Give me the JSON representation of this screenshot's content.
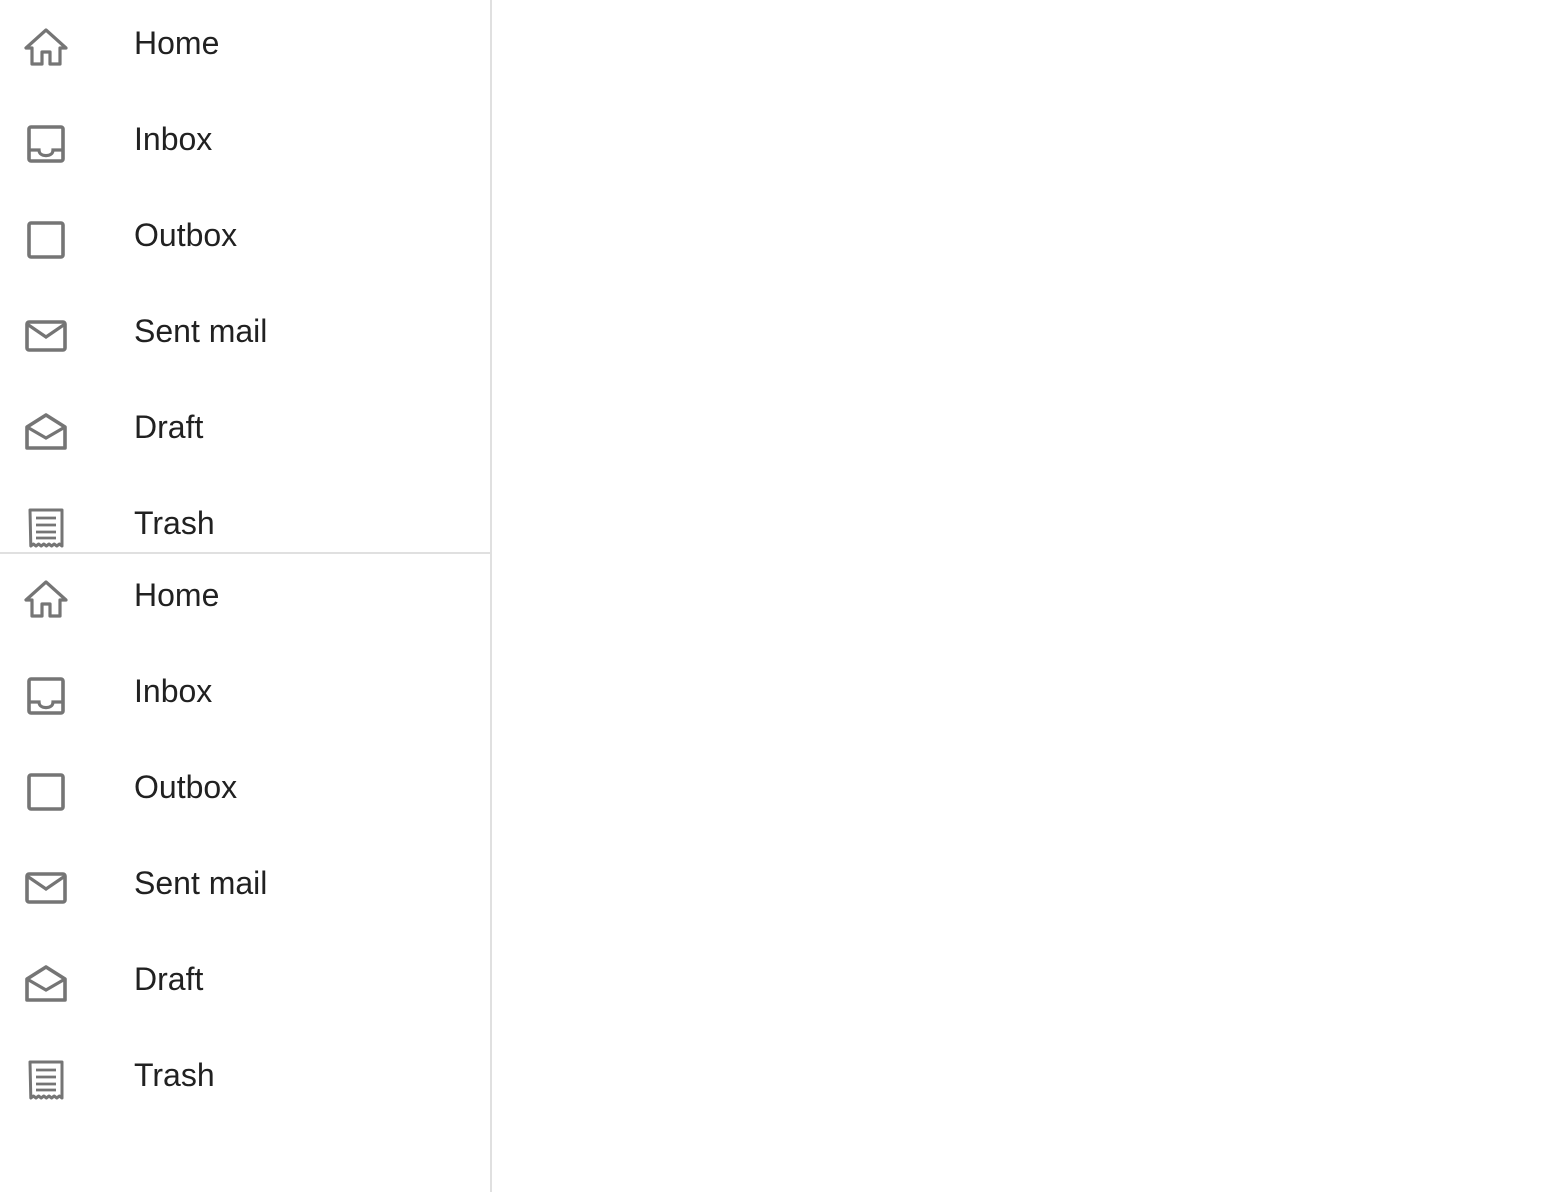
{
  "drawer": {
    "sections": [
      {
        "items": [
          {
            "label": "Home",
            "icon": "home-icon"
          },
          {
            "label": "Inbox",
            "icon": "inbox-icon"
          },
          {
            "label": "Outbox",
            "icon": "outbox-icon"
          },
          {
            "label": "Sent mail",
            "icon": "mail-icon"
          },
          {
            "label": "Draft",
            "icon": "drafts-icon"
          },
          {
            "label": "Trash",
            "icon": "receipt-icon"
          }
        ]
      },
      {
        "items": [
          {
            "label": "Home",
            "icon": "home-icon"
          },
          {
            "label": "Inbox",
            "icon": "inbox-icon"
          },
          {
            "label": "Outbox",
            "icon": "outbox-icon"
          },
          {
            "label": "Sent mail",
            "icon": "mail-icon"
          },
          {
            "label": "Draft",
            "icon": "drafts-icon"
          },
          {
            "label": "Trash",
            "icon": "receipt-icon"
          }
        ]
      }
    ]
  },
  "colors": {
    "icon": "#757575",
    "text": "#212121",
    "divider": "#e0e0e0"
  }
}
